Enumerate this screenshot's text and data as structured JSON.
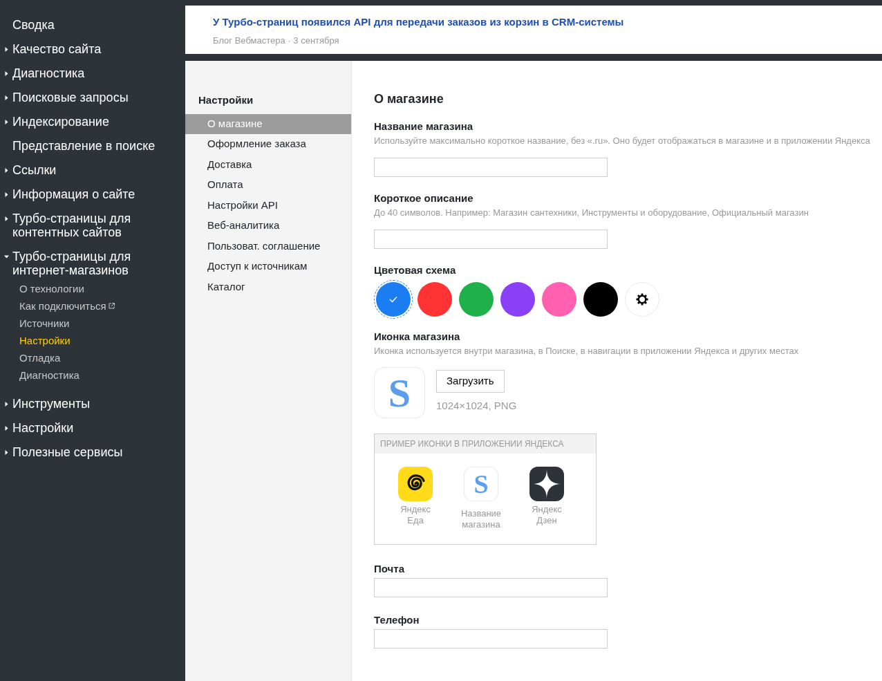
{
  "sidebar": {
    "items": [
      {
        "label": "Сводка",
        "kind": "link"
      },
      {
        "label": "Качество сайта",
        "kind": "group",
        "expanded": false
      },
      {
        "label": "Диагностика",
        "kind": "group",
        "expanded": false
      },
      {
        "label": "Поисковые запросы",
        "kind": "group",
        "expanded": false
      },
      {
        "label": "Индексирование",
        "kind": "group",
        "expanded": false
      },
      {
        "label": "Представление в поиске",
        "kind": "link"
      },
      {
        "label": "Ссылки",
        "kind": "group",
        "expanded": false
      },
      {
        "label": "Информация о сайте",
        "kind": "group",
        "expanded": false
      },
      {
        "label": "Турбо-страницы для контентных сайтов",
        "kind": "group",
        "expanded": false
      },
      {
        "label": "Турбо-страницы для интернет-магазинов",
        "kind": "group",
        "expanded": true,
        "children": [
          {
            "label": "О технологии",
            "selected": false,
            "external": false
          },
          {
            "label": "Как подключиться",
            "selected": false,
            "external": true
          },
          {
            "label": "Источники",
            "selected": false,
            "external": false
          },
          {
            "label": "Настройки",
            "selected": true,
            "external": false
          },
          {
            "label": "Отладка",
            "selected": false,
            "external": false
          },
          {
            "label": "Диагностика",
            "selected": false,
            "external": false
          }
        ]
      },
      {
        "label": "Инструменты",
        "kind": "group",
        "expanded": false
      },
      {
        "label": "Настройки",
        "kind": "group",
        "expanded": false
      },
      {
        "label": "Полезные сервисы",
        "kind": "group",
        "expanded": false
      }
    ]
  },
  "announcement": {
    "title": "У Турбо-страниц появился API для передачи заказов из корзин в CRM-системы",
    "source": "Блог Вебмастера",
    "separator": "·",
    "date": "3 сентября"
  },
  "settings_nav": {
    "title": "Настройки",
    "items": [
      {
        "label": "О магазине",
        "selected": true
      },
      {
        "label": "Оформление заказа",
        "selected": false
      },
      {
        "label": "Доставка",
        "selected": false
      },
      {
        "label": "Оплата",
        "selected": false
      },
      {
        "label": "Настройки API",
        "selected": false
      },
      {
        "label": "Веб-аналитика",
        "selected": false
      },
      {
        "label": "Пользоват. соглашение",
        "selected": false
      },
      {
        "label": "Доступ к источникам",
        "selected": false
      },
      {
        "label": "Каталог",
        "selected": false
      }
    ]
  },
  "content": {
    "title": "О магазине",
    "shop_name": {
      "label": "Название магазина",
      "hint": "Используйте максимально короткое название, без «.ru». Оно будет отображаться в магазине и в приложении Яндекса"
    },
    "short_description": {
      "label": "Короткое описание",
      "hint": "До 40 символов. Например: Магазин сантехники, Инструменты и оборудование, Официальный магазин"
    },
    "color_scheme": {
      "label": "Цветовая схема",
      "options": [
        {
          "kind": "swatch",
          "color": "#1a7df2",
          "selected": true
        },
        {
          "kind": "swatch",
          "color": "#ff3333",
          "selected": false
        },
        {
          "kind": "swatch",
          "color": "#1fb04a",
          "selected": false
        },
        {
          "kind": "swatch",
          "color": "#8a40f5",
          "selected": false
        },
        {
          "kind": "swatch",
          "color": "#ff60b0",
          "selected": false
        },
        {
          "kind": "swatch",
          "color": "#000000",
          "selected": false
        },
        {
          "kind": "custom",
          "selected": false
        }
      ]
    },
    "shop_icon": {
      "label": "Иконка магазина",
      "hint": "Иконка используется внутри магазина, в Поиске, в навигации в приложении Яндекса и других местах",
      "icon_letter": "S",
      "upload_button": "Загрузить",
      "size_note": "1024×1024, PNG"
    },
    "preview": {
      "title": "ПРИМЕР ИКОНКИ В ПРИЛОЖЕНИИ ЯНДЕКСА",
      "apps": [
        {
          "kind": "spiral",
          "label": "Яндекс Еда"
        },
        {
          "kind": "shop",
          "letter": "S",
          "label": "Название магазина"
        },
        {
          "kind": "star",
          "label": "Яндекс Дзен"
        }
      ]
    },
    "email": {
      "label": "Почта"
    },
    "phone": {
      "label": "Телефон"
    }
  }
}
